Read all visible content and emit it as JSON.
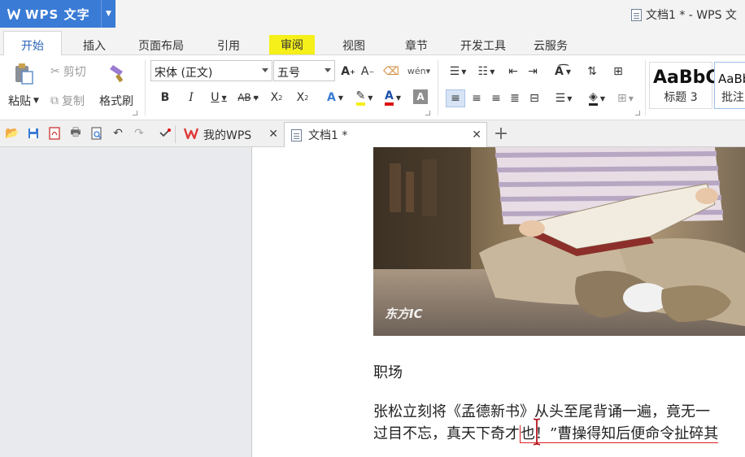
{
  "app": {
    "name": "WPS 文字",
    "window_title": "文档1 * - WPS 文"
  },
  "menu_tabs": [
    "开始",
    "插入",
    "页面布局",
    "引用",
    "审阅",
    "视图",
    "章节",
    "开发工具",
    "云服务"
  ],
  "ribbon": {
    "paste": "粘贴",
    "cut": "剪切",
    "copy": "复制",
    "format_painter": "格式刷",
    "font_name": "宋体 (正文)",
    "font_size": "五号",
    "styles": [
      {
        "sample": "AaBbC",
        "caption": "标题 3"
      },
      {
        "sample": "AaBb",
        "caption": "批注"
      }
    ]
  },
  "doc_tabs": [
    {
      "label": "我的WPS"
    },
    {
      "label": "文档1 *"
    }
  ],
  "document": {
    "watermark": "东方IC",
    "heading": "职场",
    "line1": "张松立刻将《孟德新书》从头至尾背诵一遍，竟无一",
    "line2_a": "过目不忘，真天下奇才",
    "line2_b": "也！”曹操得知后便命令扯碎其"
  },
  "colors": {
    "accent": "#3a7bd5",
    "highlight": "#f5ef1a",
    "font_color_bar": "#d11",
    "highlight_bar": "#f5ef1a"
  }
}
